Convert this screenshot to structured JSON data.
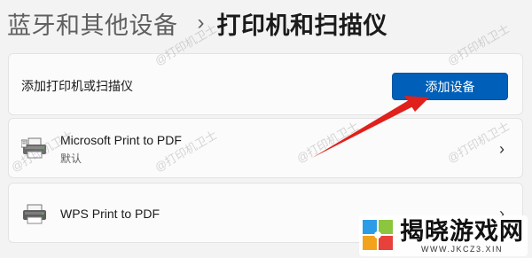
{
  "breadcrumb": {
    "parent": "蓝牙和其他设备",
    "separator": "›",
    "current": "打印机和扫描仪"
  },
  "add_section": {
    "label": "添加打印机或扫描仪",
    "button_label": "添加设备"
  },
  "printers": [
    {
      "name": "Microsoft Print to PDF",
      "status": "默认",
      "icon": "printer-icon"
    },
    {
      "name": "WPS Print to PDF",
      "status": "",
      "icon": "printer-icon"
    }
  ],
  "chevron": "›",
  "watermark": "@打印机卫士",
  "logo": {
    "title": "揭晓游戏网",
    "url": "WWW.JKCZ3.XIN"
  },
  "colors": {
    "accent": "#005fb8",
    "arrow": "#e0201b",
    "background": "#f3f3f3"
  }
}
